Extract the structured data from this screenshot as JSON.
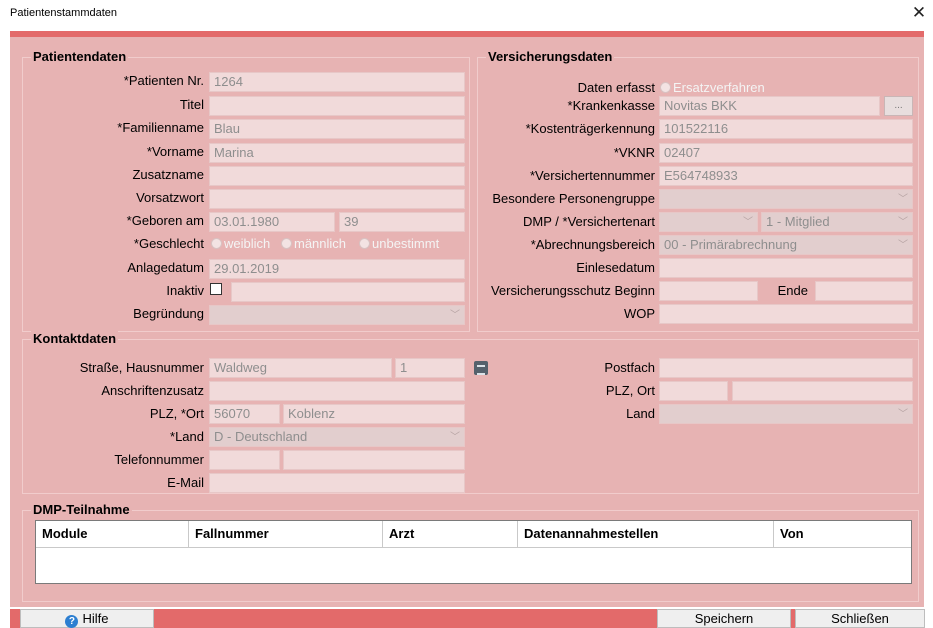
{
  "window": {
    "title": "Patientenstammdaten"
  },
  "patient": {
    "legend": "Patientendaten",
    "patnr_label": "*Patienten Nr.",
    "patnr": "1264",
    "titel_label": "Titel",
    "titel": "",
    "familienname_label": "*Familienname",
    "familienname": "Blau",
    "vorname_label": "*Vorname",
    "vorname": "Marina",
    "zusatzname_label": "Zusatzname",
    "zusatzname": "",
    "vorsatzwort_label": "Vorsatzwort",
    "vorsatzwort": "",
    "geboren_label": "*Geboren am",
    "geboren": "03.01.1980",
    "alter": "39",
    "geschlecht_label": "*Geschlecht",
    "geschlecht_options": [
      "weiblich",
      "männlich",
      "unbestimmt"
    ],
    "anlagedatum_label": "Anlagedatum",
    "anlagedatum": "29.01.2019",
    "inaktiv_label": "Inaktiv",
    "inaktiv_text": "",
    "begruendung_label": "Begründung",
    "begruendung": ""
  },
  "versicherung": {
    "legend": "Versicherungsdaten",
    "erfasst_label": "Daten erfasst",
    "erfasst_option": "Ersatzverfahren",
    "krankenkasse_label": "*Krankenkasse",
    "krankenkasse": "Novitas BKK",
    "dots": "...",
    "ktk_label": "*Kostenträgerkennung",
    "ktk": "101522116",
    "vknr_label": "*VKNR",
    "vknr": "02407",
    "vnr_label": "*Versichertennummer",
    "vnr": "E564748933",
    "bpg_label": "Besondere Personengruppe",
    "bpg": "",
    "dmp_label": "DMP / *Versichertenart",
    "dmp": "",
    "versichertenart": "1 - Mitglied",
    "abrechnung_label": "*Abrechnungsbereich",
    "abrechnung": "00 - Primärabrechnung",
    "einlese_label": "Einlesedatum",
    "einlese": "",
    "beginn_label": "Versicherungsschutz Beginn",
    "beginn": "",
    "ende_label": "Ende",
    "ende": "",
    "wop_label": "WOP",
    "wop": ""
  },
  "kontakt": {
    "legend": "Kontaktdaten",
    "strasse_label": "Straße, Hausnummer",
    "strasse": "Waldweg",
    "hausnummer": "1",
    "zusatz_label": "Anschriftenzusatz",
    "zusatz": "",
    "plzort_label": "PLZ, *Ort",
    "plz": "56070",
    "ort": "Koblenz",
    "land_label": "*Land",
    "land": "D - Deutschland",
    "telefon_label": "Telefonnummer",
    "telefon_vorwahl": "",
    "telefon": "",
    "email_label": "E-Mail",
    "email": "",
    "postfach_label": "Postfach",
    "postfach": "",
    "plzort2_label": "PLZ, Ort",
    "plz2": "",
    "ort2": "",
    "land2_label": "Land",
    "land2": ""
  },
  "dmp": {
    "legend": "DMP-Teilnahme",
    "columns": [
      "Module",
      "Fallnummer",
      "Arzt",
      "Datenannahmestellen",
      "Von"
    ]
  },
  "buttons": {
    "hilfe": "Hilfe",
    "speichern": "Speichern",
    "schliessen": "Schließen"
  },
  "icons": {
    "close": "close-icon",
    "help": "help-icon",
    "card": "address-card-icon",
    "dropdown": "chevron-down-icon"
  },
  "colors": {
    "accent": "#e36a6a",
    "panel": "#e7b3b3"
  }
}
